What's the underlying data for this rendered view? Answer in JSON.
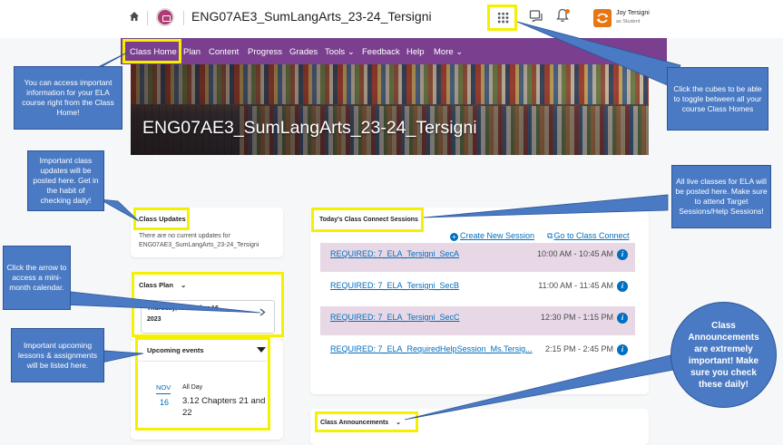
{
  "header": {
    "course_title": "ENG07AE3_SumLangArts_23-24_Tersigni",
    "user_name": "Joy Tersigni",
    "user_role": "as Student",
    "icons": [
      "home-icon",
      "course-logo-icon",
      "waffle-icon",
      "chat-icon",
      "bell-icon",
      "avatar"
    ]
  },
  "nav": {
    "items": [
      "Class Home",
      "Plan",
      "Content",
      "Progress",
      "Grades",
      "Tools",
      "Feedback",
      "Help",
      "More"
    ]
  },
  "banner": {
    "title": "ENG07AE3_SumLangArts_23-24_Tersigni"
  },
  "class_updates": {
    "heading": "Class Updates",
    "message": "There are no current updates for",
    "message2": "ENG07AE3_SumLangArts_23-24_Tersigni"
  },
  "class_plan": {
    "heading": "Class Plan",
    "date_line1": "Thursday, November 16,",
    "date_line2": "2023"
  },
  "upcoming": {
    "heading": "Upcoming events",
    "month": "NOV",
    "day": "16",
    "when": "All Day",
    "title_line1": "3.12 Chapters 21 and",
    "title_line2": "22"
  },
  "sessions": {
    "heading": "Today's Class Connect Sessions",
    "create_label": "Create New Session",
    "goto_label": "Go to Class Connect",
    "rows": [
      {
        "name": "REQUIRED: 7_ELA_Tersigni_SecA",
        "time": "10:00 AM - 10:45 AM"
      },
      {
        "name": "REQUIRED: 7_ELA_Tersigni_SecB",
        "time": "11:00 AM - 11:45 AM"
      },
      {
        "name": "REQUIRED: 7_ELA_Tersigni_SecC",
        "time": "12:30 PM - 1:15 PM"
      },
      {
        "name": "REQUIRED: 7_ELA_RequiredHelpSession_Ms.Tersig...",
        "time": "2:15 PM - 2:45 PM"
      }
    ]
  },
  "announcements": {
    "heading": "Class Announcements"
  },
  "callouts": {
    "class_home": "You can access important information for your ELA course right from the Class Home!",
    "cubes": "Click the cubes to be able to toggle between all your course Class Homes",
    "updates": "Important class updates will be posted here. Get in the habit of checking daily!",
    "live_classes": "All live classes for ELA will be posted here. Make sure to attend Target Sessions/Help Sessions!",
    "arrow": "Click the arrow to access a mini-month calendar.",
    "upcoming": "Important upcoming lessons & assignments will be listed here.",
    "announcements": "Class Announcements are extremely important! Make sure you check these daily!"
  },
  "colors": {
    "nav_bg": "#7a3f8e",
    "highlight": "#f4f000",
    "callout": "#4a7ac3",
    "link": "#006fbf",
    "row_alt": "#e8d8e6"
  }
}
